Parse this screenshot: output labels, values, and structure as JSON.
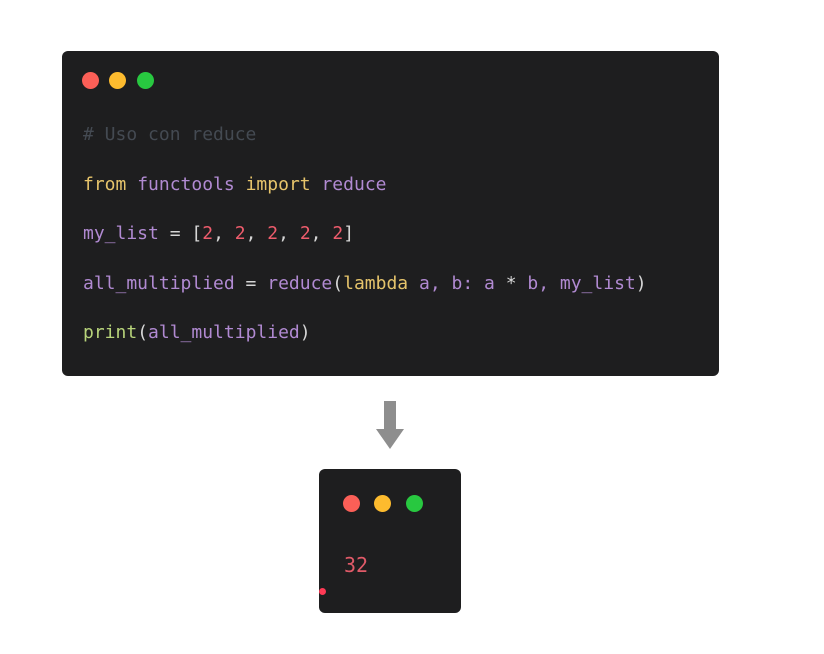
{
  "code_window": {
    "lines": {
      "comment": "# Uso con reduce",
      "import_line": {
        "kw_from": "from",
        "module": "functools",
        "kw_import": "import",
        "name": "reduce"
      },
      "assign_line": {
        "var": "my_list",
        "eq": " = ",
        "open": "[",
        "values": [
          "2",
          "2",
          "2",
          "2",
          "2"
        ],
        "sep": ", ",
        "close": "]"
      },
      "reduce_line": {
        "var": "all_multiplied",
        "eq": " = ",
        "fn": "reduce",
        "open": "(",
        "kw_lambda": "lambda",
        "params": " a, b: a ",
        "star": "*",
        "rest": " b, my_list",
        "close": ")"
      },
      "print_line": {
        "fn": "print",
        "open": "(",
        "arg": "all_multiplied",
        "close": ")"
      }
    }
  },
  "output_window": {
    "result": "32"
  },
  "colors": {
    "window_bg": "#1e1e1f",
    "dot_red": "#fb5f57",
    "dot_yellow": "#fdbb2e",
    "dot_green": "#28c840",
    "keyword": "#e6c46b",
    "identifier": "#b18ad2",
    "number": "#ee5c6c",
    "call": "#b7d37a",
    "comment": "#444a52"
  },
  "icons": {
    "arrow": "arrow-down-icon"
  }
}
